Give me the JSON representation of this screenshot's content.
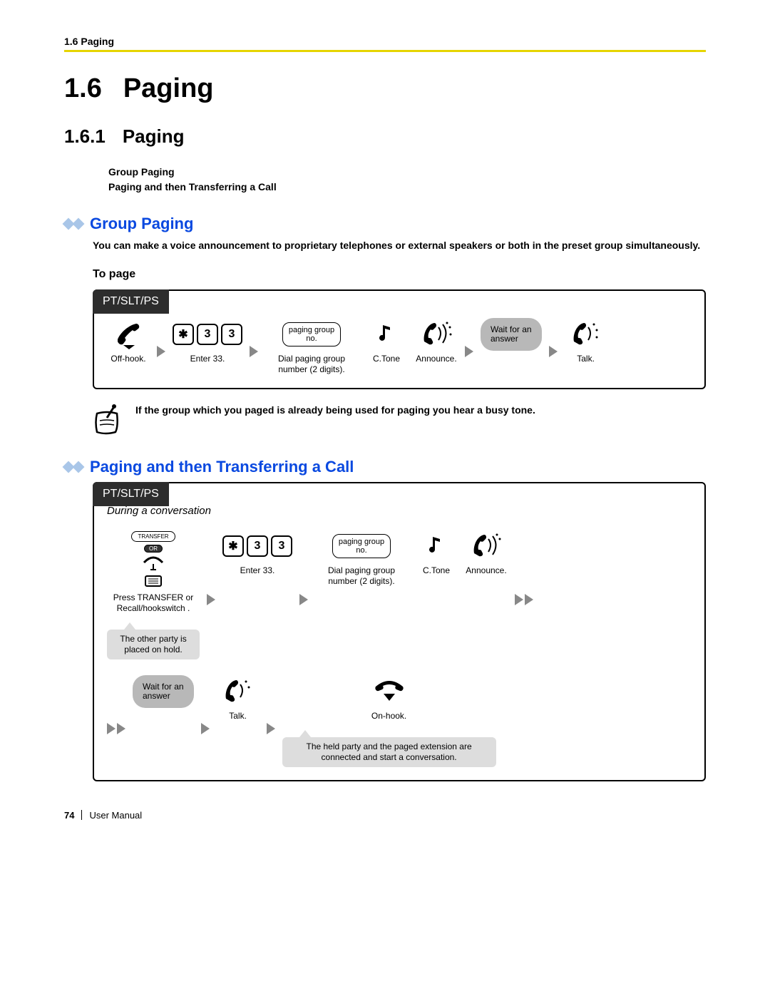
{
  "header": {
    "crumb": "1.6 Paging"
  },
  "h1": {
    "num": "1.6",
    "title": "Paging"
  },
  "h2": {
    "num": "1.6.1",
    "title": "Paging"
  },
  "toc": {
    "line1": "Group Paging",
    "line2": "Paging and then Transferring a Call"
  },
  "group_paging": {
    "title": "Group Paging",
    "desc": "You can make a voice announcement to proprietary telephones or external speakers or both in the preset group simultaneously.",
    "topage": "To page",
    "tab": "PT/SLT/PS",
    "steps": {
      "offhook": "Off-hook.",
      "enter": "Enter    33.",
      "key_star": "✱",
      "key_d1": "3",
      "key_d2": "3",
      "paging_oval": "paging group\nno.",
      "dial": "Dial paging group number  (2 digits).",
      "ctone": "C.Tone",
      "announce": "Announce.",
      "wait": "Wait for an\nanswer",
      "talk": "Talk."
    },
    "note": "If the group which you paged is already being used for paging  you hear a busy tone."
  },
  "transfer": {
    "title": "Paging and then Transferring a Call",
    "tab": "PT/SLT/PS",
    "context": "During a conversation",
    "transfer_btn": "TRANSFER",
    "or": "OR",
    "steps": {
      "press": "Press TRANSFER or Recall/hookswitch  .",
      "callout1": "The other party is placed on hold.",
      "key_star": "✱",
      "key_d1": "3",
      "key_d2": "3",
      "enter": "Enter    33.",
      "paging_oval": "paging group\nno.",
      "dial": "Dial paging group number  (2 digits).",
      "ctone": "C.Tone",
      "announce": "Announce.",
      "wait": "Wait for an\nanswer",
      "talk": "Talk.",
      "onhook": "On-hook.",
      "callout2": "The held party and the paged extension are connected and start a conversation."
    }
  },
  "footer": {
    "page": "74",
    "manual": "User Manual"
  }
}
